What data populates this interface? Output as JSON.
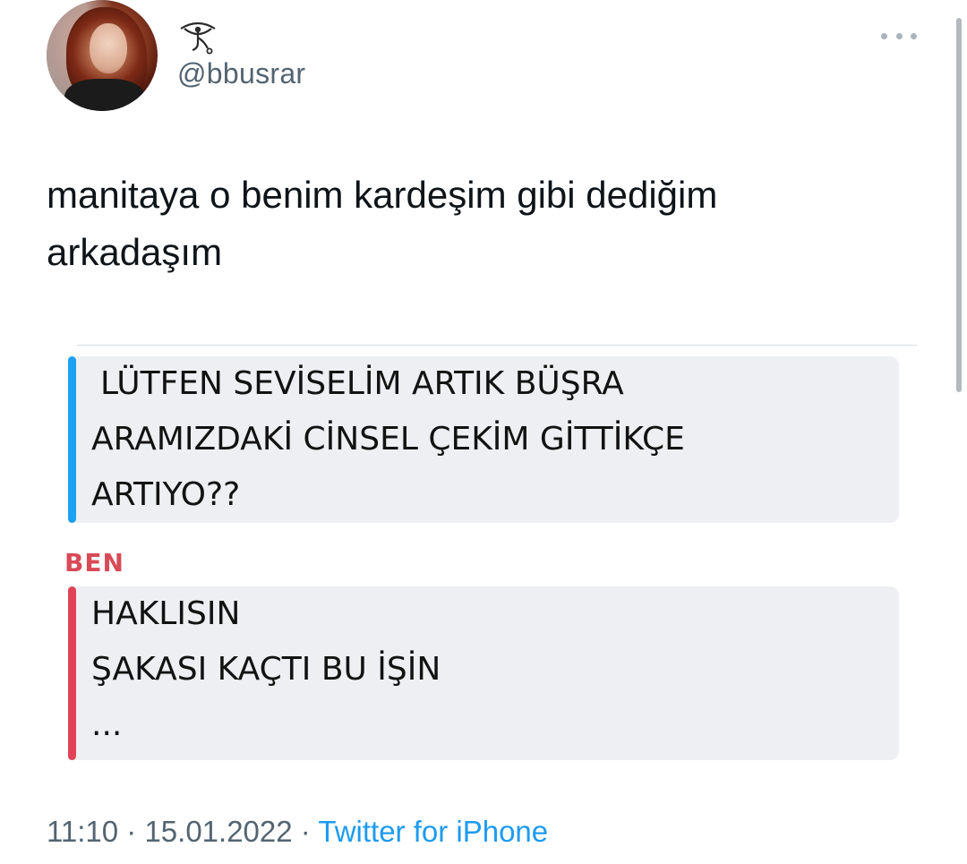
{
  "user": {
    "handle": "@bbusrar",
    "display_name_icon": "eye-symbol-icon"
  },
  "tweet": {
    "text_lines": [
      "manitaya o benim kardeşim gibi dediğim",
      "arkadaşım"
    ],
    "timestamp": "11:10 · 15.01.2022 · ",
    "source": "Twitter for iPhone"
  },
  "chat": {
    "incoming": {
      "lines": [
        "LÜTFEN SEVİSELİM ARTIK BÜŞRA",
        "ARAMIZDAKİ CİNSEL ÇEKİM GİTTİKÇE",
        "ARTIYO??"
      ],
      "accent": "#1da1f2"
    },
    "sender_label": "BEN",
    "outgoing": {
      "lines": [
        "HAKLISIN",
        "ŞAKASI KAÇTI BU İŞİN",
        "..."
      ],
      "accent": "#e14255"
    }
  },
  "colors": {
    "text": "#0f1419",
    "secondary": "#536471",
    "link": "#1d9bf0",
    "bubble_bg": "#eeeff2"
  }
}
